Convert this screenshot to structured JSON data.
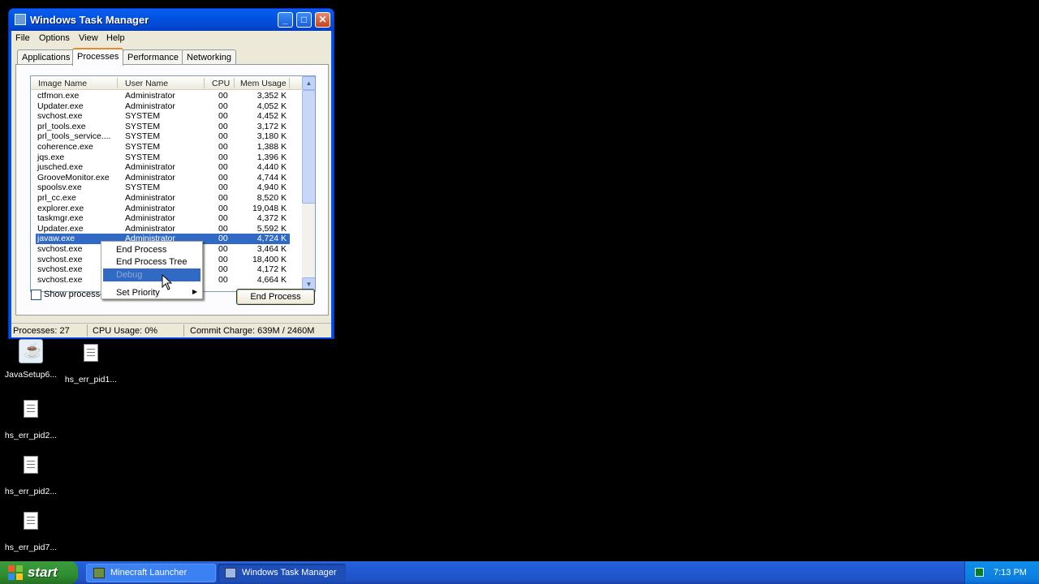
{
  "desktop_icons": [
    {
      "label": "JavaSetup6..."
    },
    {
      "label": "hs_err_pid1..."
    },
    {
      "label": "hs_err_pid2..."
    },
    {
      "label": "hs_err_pid2..."
    },
    {
      "label": "hs_err_pid7..."
    }
  ],
  "window": {
    "title": "Windows Task Manager",
    "menu": [
      "File",
      "Options",
      "View",
      "Help"
    ],
    "tabs": [
      "Applications",
      "Processes",
      "Performance",
      "Networking"
    ],
    "active_tab": "Processes",
    "columns": [
      "Image Name",
      "User Name",
      "CPU",
      "Mem Usage"
    ],
    "rows": [
      {
        "name": "ctfmon.exe",
        "user": "Administrator",
        "cpu": "00",
        "mem": "3,352 K"
      },
      {
        "name": "Updater.exe",
        "user": "Administrator",
        "cpu": "00",
        "mem": "4,052 K"
      },
      {
        "name": "svchost.exe",
        "user": "SYSTEM",
        "cpu": "00",
        "mem": "4,452 K"
      },
      {
        "name": "prl_tools.exe",
        "user": "SYSTEM",
        "cpu": "00",
        "mem": "3,172 K"
      },
      {
        "name": "prl_tools_service....",
        "user": "SYSTEM",
        "cpu": "00",
        "mem": "3,180 K"
      },
      {
        "name": "coherence.exe",
        "user": "SYSTEM",
        "cpu": "00",
        "mem": "1,388 K"
      },
      {
        "name": "jqs.exe",
        "user": "SYSTEM",
        "cpu": "00",
        "mem": "1,396 K"
      },
      {
        "name": "jusched.exe",
        "user": "Administrator",
        "cpu": "00",
        "mem": "4,440 K"
      },
      {
        "name": "GrooveMonitor.exe",
        "user": "Administrator",
        "cpu": "00",
        "mem": "4,744 K"
      },
      {
        "name": "spoolsv.exe",
        "user": "SYSTEM",
        "cpu": "00",
        "mem": "4,940 K"
      },
      {
        "name": "prl_cc.exe",
        "user": "Administrator",
        "cpu": "00",
        "mem": "8,520 K"
      },
      {
        "name": "explorer.exe",
        "user": "Administrator",
        "cpu": "00",
        "mem": "19,048 K"
      },
      {
        "name": "taskmgr.exe",
        "user": "Administrator",
        "cpu": "00",
        "mem": "4,372 K"
      },
      {
        "name": "Updater.exe",
        "user": "Administrator",
        "cpu": "00",
        "mem": "5,592 K"
      },
      {
        "name": "javaw.exe",
        "user": "Administrator",
        "cpu": "00",
        "mem": "4,724 K",
        "selected": true
      },
      {
        "name": "svchost.exe",
        "user": "",
        "cpu": "00",
        "mem": "3,464 K"
      },
      {
        "name": "svchost.exe",
        "user": "",
        "cpu": "00",
        "mem": "18,400 K"
      },
      {
        "name": "svchost.exe",
        "user": "",
        "cpu": "00",
        "mem": "4,172 K"
      },
      {
        "name": "svchost.exe",
        "user": "",
        "cpu": "00",
        "mem": "4,664 K"
      }
    ],
    "show_processes_label": "Show processes",
    "end_process_button": "End Process",
    "status": {
      "processes": "Processes: 27",
      "cpu": "CPU Usage: 0%",
      "commit": "Commit Charge: 639M / 2460M"
    }
  },
  "context_menu": {
    "items": [
      "End Process",
      "End Process Tree",
      "Debug",
      "Set Priority"
    ],
    "highlighted": "Debug"
  },
  "taskbar": {
    "start": "start",
    "tasks": [
      "Minecraft Launcher",
      "Windows Task Manager"
    ],
    "clock": "7:13 PM"
  }
}
